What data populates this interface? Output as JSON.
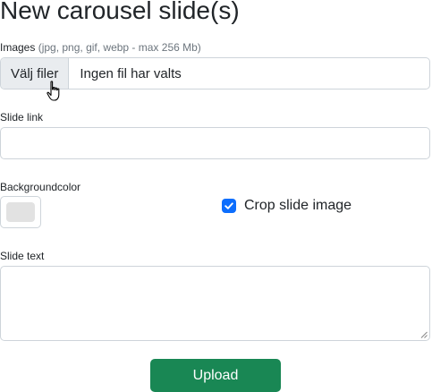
{
  "page": {
    "title": "New carousel slide(s)"
  },
  "images": {
    "label": "Images",
    "hint": "(jpg, png, gif, webp - max 256 Mb)",
    "button_label": "Välj filer",
    "status_text": "Ingen fil har valts"
  },
  "slide_link": {
    "label": "Slide link",
    "value": ""
  },
  "background_color": {
    "label": "Backgroundcolor",
    "value": "#e2e2e2"
  },
  "crop": {
    "label": "Crop slide image",
    "checked": true
  },
  "slide_text": {
    "label": "Slide text",
    "value": ""
  },
  "actions": {
    "upload_label": "Upload"
  },
  "colors": {
    "primary": "#0d6efd",
    "success": "#198754",
    "border": "#ced4da",
    "file_button_bg": "#e9ecef"
  },
  "icons": {
    "cursor": "hand-pointer-icon",
    "checkbox": "checkmark-icon"
  }
}
